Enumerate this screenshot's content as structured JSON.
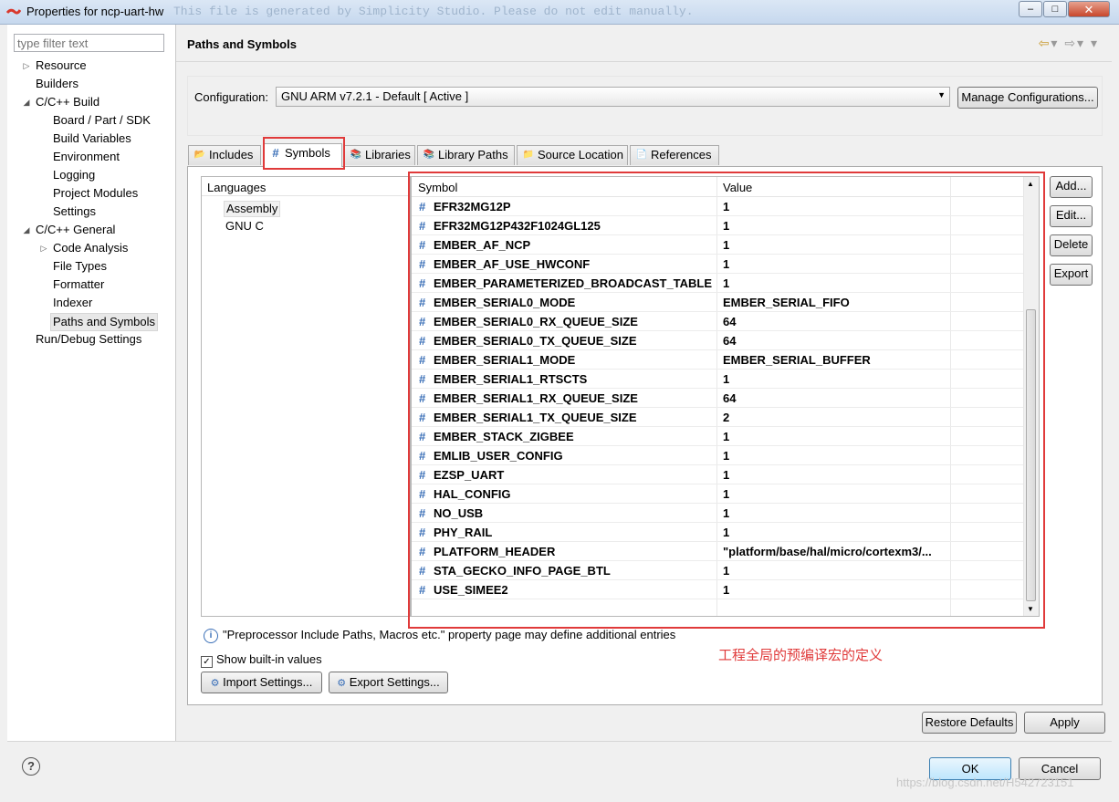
{
  "window": {
    "title": "Properties for ncp-uart-hw",
    "bg_hint_text": "This file is generated by Simplicity Studio. Please do not edit manually.",
    "minimize": "–",
    "maximize": "□",
    "close": "✕"
  },
  "sidebar": {
    "filter_placeholder": "type filter text",
    "items": [
      {
        "label": "Resource",
        "expander": "▷"
      },
      {
        "label": "Builders",
        "expander": ""
      },
      {
        "label": "C/C++ Build",
        "expander": "◢"
      },
      {
        "label": "Board / Part / SDK",
        "expander": ""
      },
      {
        "label": "Build Variables",
        "expander": ""
      },
      {
        "label": "Environment",
        "expander": ""
      },
      {
        "label": "Logging",
        "expander": ""
      },
      {
        "label": "Project Modules",
        "expander": ""
      },
      {
        "label": "Settings",
        "expander": ""
      },
      {
        "label": "C/C++ General",
        "expander": "◢"
      },
      {
        "label": "Code Analysis",
        "expander": "▷"
      },
      {
        "label": "File Types",
        "expander": ""
      },
      {
        "label": "Formatter",
        "expander": ""
      },
      {
        "label": "Indexer",
        "expander": ""
      },
      {
        "label": "Paths and Symbols",
        "expander": "",
        "selected": true
      },
      {
        "label": "Run/Debug Settings",
        "expander": ""
      }
    ]
  },
  "header": {
    "title": "Paths and Symbols",
    "nav_back": "⇦",
    "nav_forward": "⇨",
    "dropdown": "▾"
  },
  "configuration": {
    "label": "Configuration:",
    "value": "GNU ARM v7.2.1 - Default  [ Active ]",
    "arrow": "▼",
    "manage_button": "Manage Configurations..."
  },
  "tabs": [
    {
      "label": "Includes",
      "icon": "includes-icon",
      "glyph": "📂",
      "active": false
    },
    {
      "label": "Symbols",
      "icon": "hash-icon",
      "glyph": "#",
      "active": true
    },
    {
      "label": "Libraries",
      "icon": "libraries-icon",
      "glyph": "📚",
      "active": false
    },
    {
      "label": "Library Paths",
      "icon": "library-paths-icon",
      "glyph": "📚",
      "active": false
    },
    {
      "label": "Source Location",
      "icon": "source-folder-icon",
      "glyph": "📁",
      "active": false
    },
    {
      "label": "References",
      "icon": "references-icon",
      "glyph": "📄",
      "active": false
    }
  ],
  "languages": {
    "header": "Languages",
    "items": [
      "Assembly",
      "GNU C"
    ],
    "selected": "Assembly"
  },
  "symbols_table": {
    "headers": [
      "Symbol",
      "Value"
    ],
    "hash": "#",
    "rows": [
      {
        "symbol": "EFR32MG12P",
        "value": "1"
      },
      {
        "symbol": "EFR32MG12P432F1024GL125",
        "value": "1"
      },
      {
        "symbol": "EMBER_AF_NCP",
        "value": "1"
      },
      {
        "symbol": "EMBER_AF_USE_HWCONF",
        "value": "1"
      },
      {
        "symbol": "EMBER_PARAMETERIZED_BROADCAST_TABLE",
        "value": "1"
      },
      {
        "symbol": "EMBER_SERIAL0_MODE",
        "value": "EMBER_SERIAL_FIFO"
      },
      {
        "symbol": "EMBER_SERIAL0_RX_QUEUE_SIZE",
        "value": "64"
      },
      {
        "symbol": "EMBER_SERIAL0_TX_QUEUE_SIZE",
        "value": "64"
      },
      {
        "symbol": "EMBER_SERIAL1_MODE",
        "value": "EMBER_SERIAL_BUFFER"
      },
      {
        "symbol": "EMBER_SERIAL1_RTSCTS",
        "value": "1"
      },
      {
        "symbol": "EMBER_SERIAL1_RX_QUEUE_SIZE",
        "value": "64"
      },
      {
        "symbol": "EMBER_SERIAL1_TX_QUEUE_SIZE",
        "value": "2"
      },
      {
        "symbol": "EMBER_STACK_ZIGBEE",
        "value": "1"
      },
      {
        "symbol": "EMLIB_USER_CONFIG",
        "value": "1"
      },
      {
        "symbol": "EZSP_UART",
        "value": "1"
      },
      {
        "symbol": "HAL_CONFIG",
        "value": "1"
      },
      {
        "symbol": "NO_USB",
        "value": "1"
      },
      {
        "symbol": "PHY_RAIL",
        "value": "1"
      },
      {
        "symbol": "PLATFORM_HEADER",
        "value": "\"platform/base/hal/micro/cortexm3/..."
      },
      {
        "symbol": "STA_GECKO_INFO_PAGE_BTL",
        "value": "1"
      },
      {
        "symbol": "USE_SIMEE2",
        "value": "1"
      }
    ]
  },
  "side_buttons": {
    "add": "Add...",
    "edit": "Edit...",
    "delete": "Delete",
    "export": "Export"
  },
  "info_text": "\"Preprocessor Include Paths, Macros etc.\" property page may define additional entries",
  "show_builtin": {
    "label": "Show built-in values",
    "checked": true
  },
  "import_button": "Import Settings...",
  "export_button": "Export Settings...",
  "annotation": "工程全局的预编译宏的定义",
  "restore_defaults": "Restore Defaults",
  "apply": "Apply",
  "ok": "OK",
  "cancel": "Cancel",
  "help": "?",
  "watermark": "https://blog.csdn.net/H542723151",
  "colors": {
    "highlight_red": "#e03a3a",
    "hash_blue": "#3a6fb7"
  }
}
